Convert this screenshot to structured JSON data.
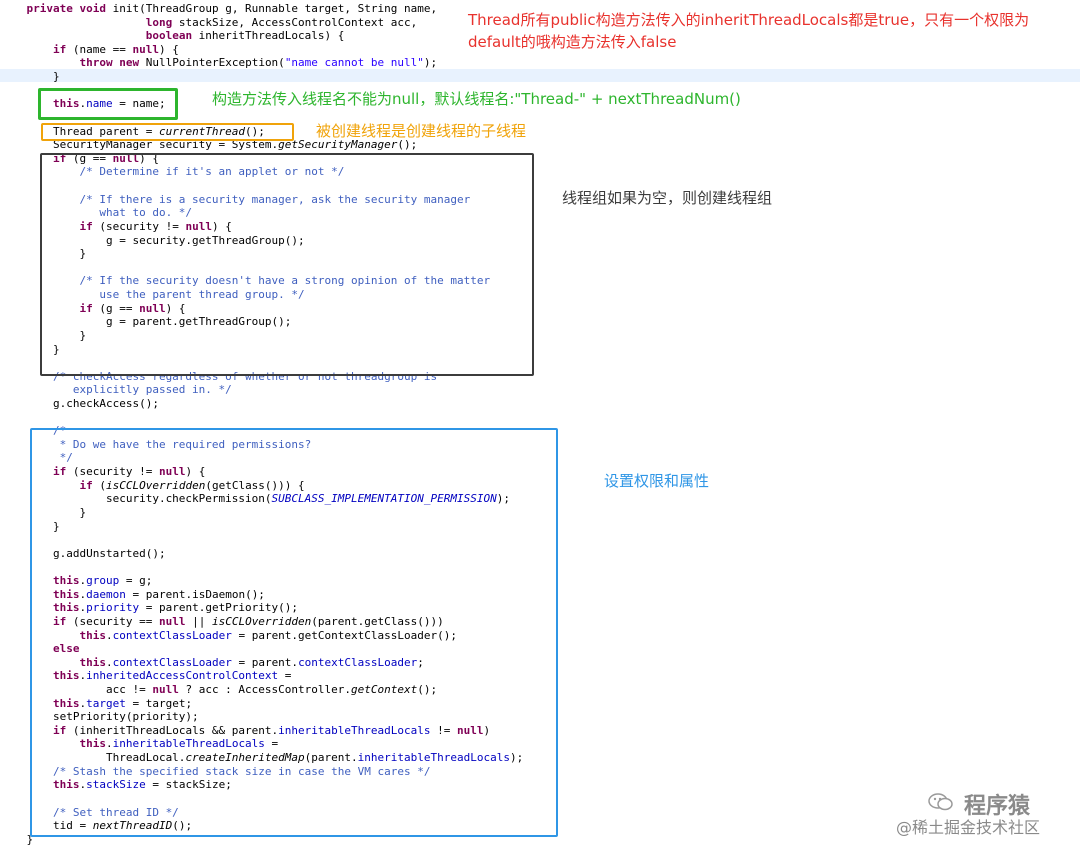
{
  "code_lines": [
    "    private void init(ThreadGroup g, Runnable target, String name,",
    "                      long stackSize, AccessControlContext acc,",
    "                      boolean inheritThreadLocals) {",
    "        if (name == null) {",
    "            throw new NullPointerException(\"name cannot be null\");",
    "        }",
    "",
    "        this.name = name;",
    "",
    "        Thread parent = currentThread();",
    "        SecurityManager security = System.getSecurityManager();",
    "        if (g == null) {",
    "            /* Determine if it's an applet or not */",
    "",
    "            /* If there is a security manager, ask the security manager",
    "               what to do. */",
    "            if (security != null) {",
    "                g = security.getThreadGroup();",
    "            }",
    "",
    "            /* If the security doesn't have a strong opinion of the matter",
    "               use the parent thread group. */",
    "            if (g == null) {",
    "                g = parent.getThreadGroup();",
    "            }",
    "        }",
    "",
    "        /* checkAccess regardless of whether or not threadgroup is",
    "           explicitly passed in. */",
    "        g.checkAccess();",
    "",
    "        /*",
    "         * Do we have the required permissions?",
    "         */",
    "        if (security != null) {",
    "            if (isCCLOverridden(getClass())) {",
    "                security.checkPermission(SUBCLASS_IMPLEMENTATION_PERMISSION);",
    "            }",
    "        }",
    "",
    "        g.addUnstarted();",
    "",
    "        this.group = g;",
    "        this.daemon = parent.isDaemon();",
    "        this.priority = parent.getPriority();",
    "        if (security == null || isCCLOverridden(parent.getClass()))",
    "            this.contextClassLoader = parent.getContextClassLoader();",
    "        else",
    "            this.contextClassLoader = parent.contextClassLoader;",
    "        this.inheritedAccessControlContext =",
    "                acc != null ? acc : AccessController.getContext();",
    "        this.target = target;",
    "        setPriority(priority);",
    "        if (inheritThreadLocals && parent.inheritableThreadLocals != null)",
    "            this.inheritableThreadLocals =",
    "                ThreadLocal.createInheritedMap(parent.inheritableThreadLocals);",
    "        /* Stash the specified stack size in case the VM cares */",
    "        this.stackSize = stackSize;",
    "",
    "        /* Set thread ID */",
    "        tid = nextThreadID();",
    "    }"
  ],
  "annotations": {
    "inherit_note_line1": "Thread所有public构造方法传入的inheritThreadLocals都是true，只有一个权限为",
    "inherit_note_line2": "default的哦构造方法传入false",
    "name_note": "构造方法传入线程名不能为null，默认线程名:\"Thread-\" + nextThreadNum()",
    "parent_note": "被创建线程是创建线程的子线程",
    "group_note": "线程组如果为空，则创建线程组",
    "permission_note": "设置权限和属性"
  },
  "watermark": {
    "line1": "程序猿",
    "line2": "@稀土掘金技术社区"
  },
  "colors": {
    "red": "#e8322d",
    "green": "#2db52d",
    "orange": "#f0a30a",
    "dark": "#3c3c3c",
    "blue": "#2f96e6"
  }
}
